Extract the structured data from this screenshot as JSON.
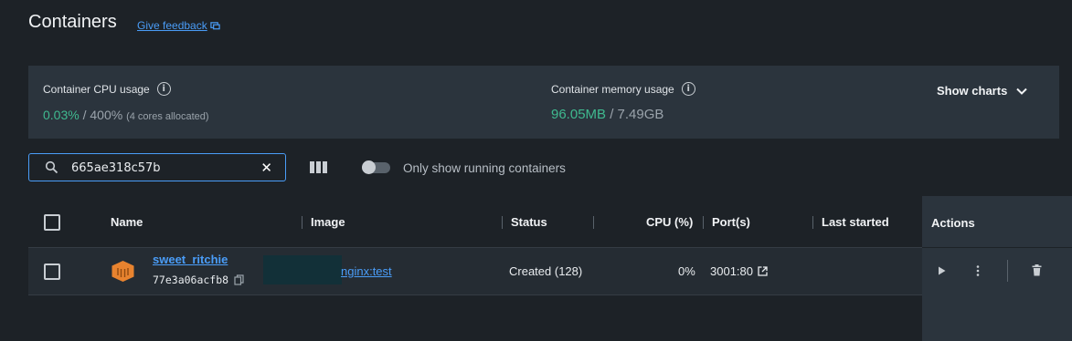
{
  "header": {
    "title": "Containers",
    "feedback_label": "Give feedback"
  },
  "stats": {
    "cpu_label": "Container CPU usage",
    "cpu_value": "0.03%",
    "cpu_total": " / 400%",
    "cpu_note": "(4 cores allocated)",
    "mem_label": "Container memory usage",
    "mem_value": "96.05MB",
    "mem_total": " / 7.49GB",
    "show_charts_label": "Show charts"
  },
  "toolbar": {
    "search_value": "665ae318c57b",
    "running_only_label": "Only show running containers",
    "running_only_enabled": false
  },
  "table": {
    "columns": [
      "Name",
      "Image",
      "Status",
      "CPU (%)",
      "Port(s)",
      "Last started",
      "Actions"
    ],
    "rows": [
      {
        "name": "sweet_ritchie",
        "id": "77e3a06acfb8",
        "image": "nginx:test",
        "status": "Created (128)",
        "cpu": "0%",
        "ports": "3001:80",
        "last_started": ""
      }
    ]
  },
  "colors": {
    "accent": "#4a9df8",
    "stat_green": "#3fb98f",
    "container_icon": "#e8832f"
  },
  "icons": [
    "feedback-icon",
    "info-icon",
    "chevron-down-icon",
    "search-icon",
    "close-icon",
    "columns-icon",
    "container-icon",
    "copy-icon",
    "external-link-icon",
    "play-icon",
    "more-vertical-icon",
    "trash-icon"
  ]
}
